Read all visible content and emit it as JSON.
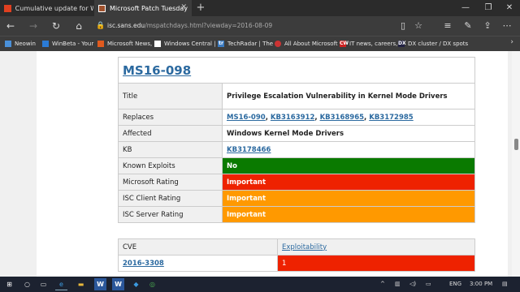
{
  "tabs": [
    {
      "title": "Cumulative update for Wind",
      "active": false
    },
    {
      "title": "Microsoft Patch Tuesday",
      "active": true
    }
  ],
  "address": {
    "domain": "isc.sans.edu",
    "path": "/mspatchdays.html?viewday=2016-08-09"
  },
  "favorites": [
    "Neowin",
    "WinBeta - Your",
    "Microsoft News,",
    "Windows Central |",
    "TechRadar | The",
    "All About Microsoft",
    "IT news, careers,",
    "DX cluster / DX spots"
  ],
  "bulletin": {
    "id": "MS16-098",
    "rows": [
      {
        "label": "Title",
        "value": "Privilege Escalation Vulnerability in Kernel Mode Drivers"
      },
      {
        "label": "Replaces",
        "links": [
          "MS16-090",
          "KB3163912",
          "KB3168965",
          "KB3172985"
        ]
      },
      {
        "label": "Affected",
        "value": "Windows Kernel Mode Drivers"
      },
      {
        "label": "KB",
        "links": [
          "KB3178466"
        ]
      },
      {
        "label": "Known Exploits",
        "value": "No"
      },
      {
        "label": "Microsoft Rating",
        "value": "Important"
      },
      {
        "label": "ISC Client Rating",
        "value": "Important"
      },
      {
        "label": "ISC Server Rating",
        "value": "Important"
      }
    ]
  },
  "cve_table": {
    "headers": [
      "CVE",
      "Exploitability"
    ],
    "rows": [
      {
        "cve": "2016-3308",
        "exploitability": "1"
      }
    ]
  },
  "taskbar": {
    "lang": "ENG",
    "time": "3:00 PM"
  },
  "colors": {
    "green": "#0a7a00",
    "red": "#ee2200",
    "orange": "#ff9900",
    "link": "#2c6aa0"
  }
}
